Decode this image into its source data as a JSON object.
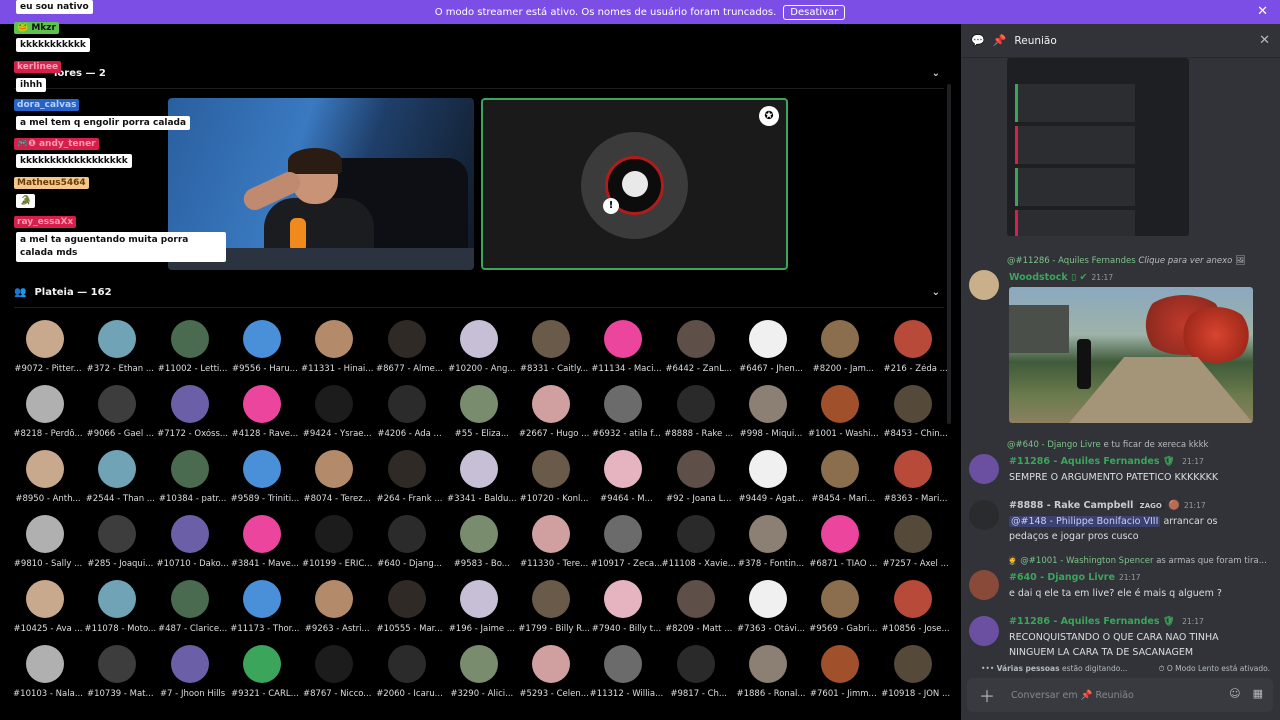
{
  "banner": {
    "text": "O modo streamer está ativo. Os nomes de usuário foram truncados.",
    "button": "Desativar"
  },
  "stage": {
    "speakers_label": "lores — 2",
    "audience_label": "Plateia — 162"
  },
  "chat_overlay": [
    {
      "name": "",
      "msg": "eu sou nativo"
    },
    {
      "name": "Mkzr",
      "msg": "kkkkkkkkkkk"
    },
    {
      "name": "kerlinee",
      "msg": "ihhh"
    },
    {
      "name": "dora_calvas",
      "msg": "a mel tem q engolir porra calada"
    },
    {
      "name": "andy_tener",
      "msg": "kkkkkkkkkkkkkkkkkk"
    },
    {
      "name": "Matheus5464",
      "msg": ""
    },
    {
      "name": "ray_essaXx",
      "msg": "a mel ta aguentando muita porra calada mds"
    }
  ],
  "audience": [
    [
      "#9072 - Pitter...",
      "#372 - Ethan ...",
      "#11002 - Letti...",
      "#9556 - Haru...",
      "#11331 - Hinai...",
      "#8677 - Alme...",
      "#10200 - Ang...",
      "#8331 - Caitly...",
      "#11134 - Maci...",
      "#6442 - ZanL...",
      "#6467 - Jhen...",
      "#8200 - Jam...",
      "#216 - Zéda ..."
    ],
    [
      "#8218 - Perdô...",
      "#9066 - Gael ...",
      "#7172 - Oxóss...",
      "#4128 - Rave...",
      "#9424 - Ysrae...",
      "#4206 - Ada ...",
      "#55 - Eliza...",
      "#2667 - Hugo ...",
      "#6932 - atila f...",
      "#8888 - Rake ...",
      "#998 - Miqui...",
      "#1001 - Washi...",
      "#8453 - Chin..."
    ],
    [
      "#8950 - Anth...",
      "#2544 - Than ...",
      "#10384 - patr...",
      "#9589 - Triniti...",
      "#8074 - Terez...",
      "#264 - Frank ...",
      "#3341 - Baldu...",
      "#10720 - Konl...",
      "#9464 - M...",
      "#92 - Joana L...",
      "#9449 - Agat...",
      "#8454 - Mari...",
      "#8363 - Mari..."
    ],
    [
      "#9810 - Sally ...",
      "#285 - Joaqui...",
      "#10710 - Dako...",
      "#3841 - Mave...",
      "#10199 - ERIC...",
      "#640 - Djang...",
      "#9583 - Bo...",
      "#11330 - Tere...",
      "#10917 - Zeca...",
      "#11108 - Xavie...",
      "#378 - Fontin...",
      "#6871 - TIAO ...",
      "#7257 - Axel ..."
    ],
    [
      "#10425 - Ava ...",
      "#11078 - Moto...",
      "#487 - Clarice...",
      "#11173 - Thor...",
      "#9263 - Astri...",
      "#10555 - Mar...",
      "#196 - Jaime ...",
      "#1799 - Billy R...",
      "#7940 - Billy t...",
      "#8209 - Matt ...",
      "#7363 - Otávi...",
      "#9569 - Gabri...",
      "#10856 - Jose..."
    ],
    [
      "#10103 - Nala...",
      "#10739 - Mat...",
      "#7 - Jhoon Hills",
      "#9321 - CARL...",
      "#8767 - Nicco...",
      "#2060 - Icaru...",
      "#3290 - Alici...",
      "#5293 - Celen...",
      "#11312 - Willia...",
      "#9817 - Ch...",
      "#1886 - Ronal...",
      "#7601 - Jimm...",
      "#10918 - JON ..."
    ]
  ],
  "right": {
    "title": "Reunião",
    "reply1_author": "@#11286 - Aquiles Fernandes",
    "reply1_text": "Clique para ver anexo",
    "woodstock_author": "Woodstock",
    "woodstock_time": "21:17",
    "msgs": [
      {
        "reply_author": "@#640 - Django  Livre",
        "reply_text": "e tu ficar de xereca kkkk",
        "author": "#11286 - Aquiles Fernandes",
        "time": "21:17",
        "text": "SEMPRE O ARGUMENTO PATETICO KKKKKKK"
      },
      {
        "author": "#8888 - Rake Campbell",
        "tag": "ZAGO",
        "time": "21:17",
        "mention": "@#148 - Philippe Bonifacio VIII",
        "text": " arrancar os pedaços e jogar pros cusco"
      },
      {
        "reply_author": "@#1001 - Washington  Spencer",
        "reply_text": "as armas que foram tira...",
        "author": "#640 - Django  Livre",
        "time": "21:17",
        "text": "e dai q ele ta em live? ele é mais q alguem ?"
      },
      {
        "author": "#11286 - Aquiles Fernandes",
        "time": "21:17",
        "text": "RECONQUISTANDO O QUE CARA NAO TINHA NINGUEM LA CARA TA DE SACANAGEM"
      }
    ],
    "typing_bold": "Várias pessoas",
    "typing_rest": " estão digitando...",
    "slowmode": "O Modo Lento está ativado.",
    "composer_prefix": "Conversar em",
    "composer_channel": "Reunião"
  },
  "colors": {
    "accent": "#7d4ee6",
    "green": "#3ba55c",
    "discord_pink": "#eb459e"
  }
}
